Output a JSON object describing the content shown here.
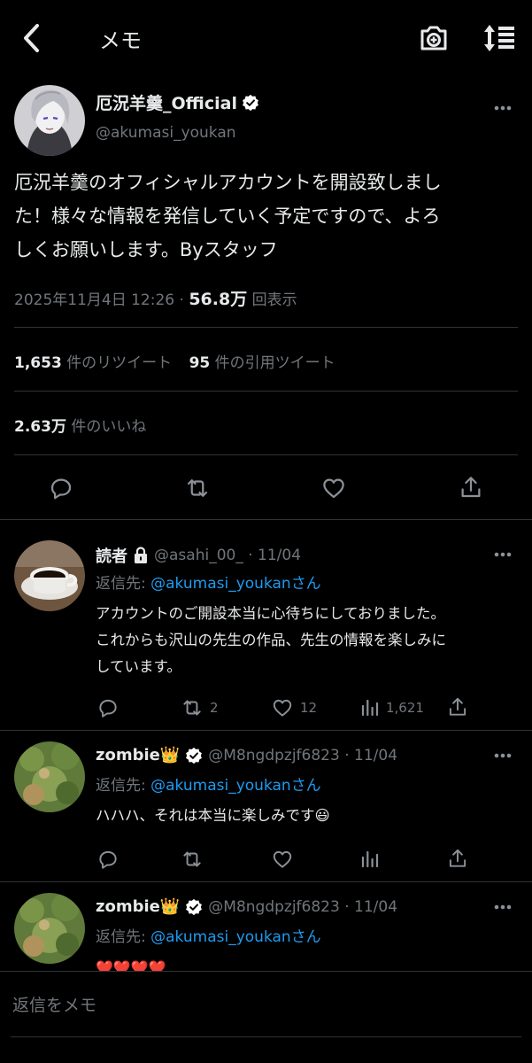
{
  "header": {
    "title": "メモ"
  },
  "tweet": {
    "author_name": "厄況羊羹_Official",
    "handle": "@akumasi_youkan",
    "text_lines": [
      "厄況羊羹のオフィシャルアカウントを開設致しまし",
      "た！様々な情報を発信していく予定ですので、よろ",
      "しくお願いします。Byスタッフ"
    ],
    "timestamp": "2025年11月4日 12:26 ·",
    "views_value": "56.8万",
    "views_label": "回表示",
    "retweets_value": "1,653",
    "retweets_label": "件のリツイート",
    "quotes_value": "95",
    "quotes_label": "件の引用ツイート",
    "likes_value": "2.63万",
    "likes_label": "件のいいね"
  },
  "replies": [
    {
      "name": "読者",
      "locked": true,
      "meta": "@asahi_00_ · 11/04",
      "reply_to_prefix": "返信先: ",
      "reply_to_handle": "@akumasi_youkan",
      "reply_to_suffix": "さん",
      "text_lines": [
        "アカウントのご開設本当に心待ちにしておりました。",
        "これからも沢山の先生の作品、先生の情報を楽しみに",
        "しています。"
      ],
      "retweets": "2",
      "likes": "12",
      "views": "1,621"
    },
    {
      "name": "zombie👑",
      "meta": "@M8ngdpzjf6823 · 11/04",
      "reply_to_prefix": "返信先: ",
      "reply_to_handle": "@akumasi_youkan",
      "reply_to_suffix": "さん",
      "text_lines": [
        "ハハハ、それは本当に楽しみです😃"
      ]
    },
    {
      "name": "zombie👑",
      "meta": "@M8ngdpzjf6823 · 11/04",
      "reply_to_prefix": "返信先: ",
      "reply_to_handle": "@akumasi_youkan",
      "reply_to_suffix": "さん",
      "text_lines": [
        "❤️❤️❤️❤️"
      ]
    }
  ],
  "composer": {
    "placeholder": "返信をメモ"
  },
  "colors": {
    "background": "#000000",
    "link": "#1d9bf0",
    "muted": "#71767b",
    "verified": "#ffffff",
    "divider": "#2f3336"
  },
  "icons": [
    "back-chevron-icon",
    "camera-plus-icon",
    "sort-icon",
    "verified-icon",
    "more-icon",
    "lock-icon",
    "reply-icon",
    "retweet-icon",
    "like-icon",
    "share-icon",
    "views-icon"
  ]
}
